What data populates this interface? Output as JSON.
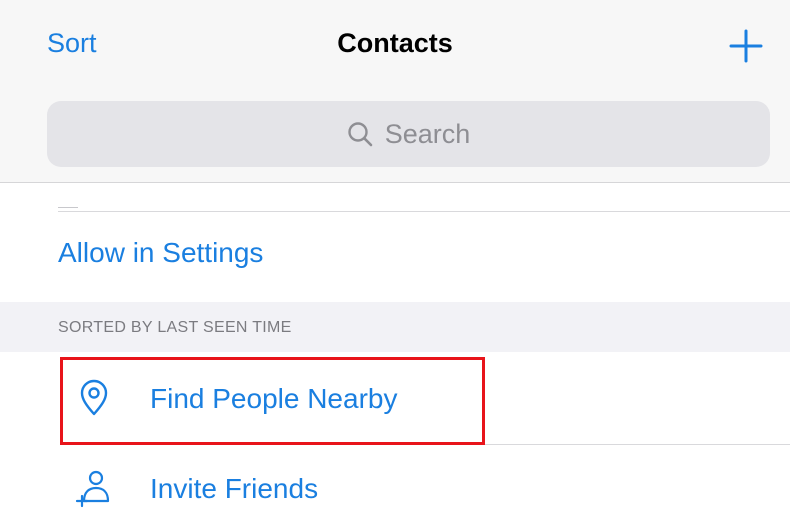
{
  "nav": {
    "sort_label": "Sort",
    "title": "Contacts",
    "add_icon": "plus-icon"
  },
  "search": {
    "placeholder": "Search",
    "icon": "search-icon"
  },
  "permission": {
    "link_label": "Allow in Settings"
  },
  "section": {
    "title": "SORTED BY LAST SEEN TIME"
  },
  "rows": [
    {
      "label": "Find People Nearby",
      "icon": "location-pin-icon"
    },
    {
      "label": "Invite Friends",
      "icon": "add-person-icon"
    }
  ],
  "colors": {
    "accent": "#1a7fe0",
    "highlight": "#e8141a",
    "header_bg": "#f7f7f7",
    "search_bg": "#e4e4e8",
    "section_bg": "#f2f2f6"
  }
}
